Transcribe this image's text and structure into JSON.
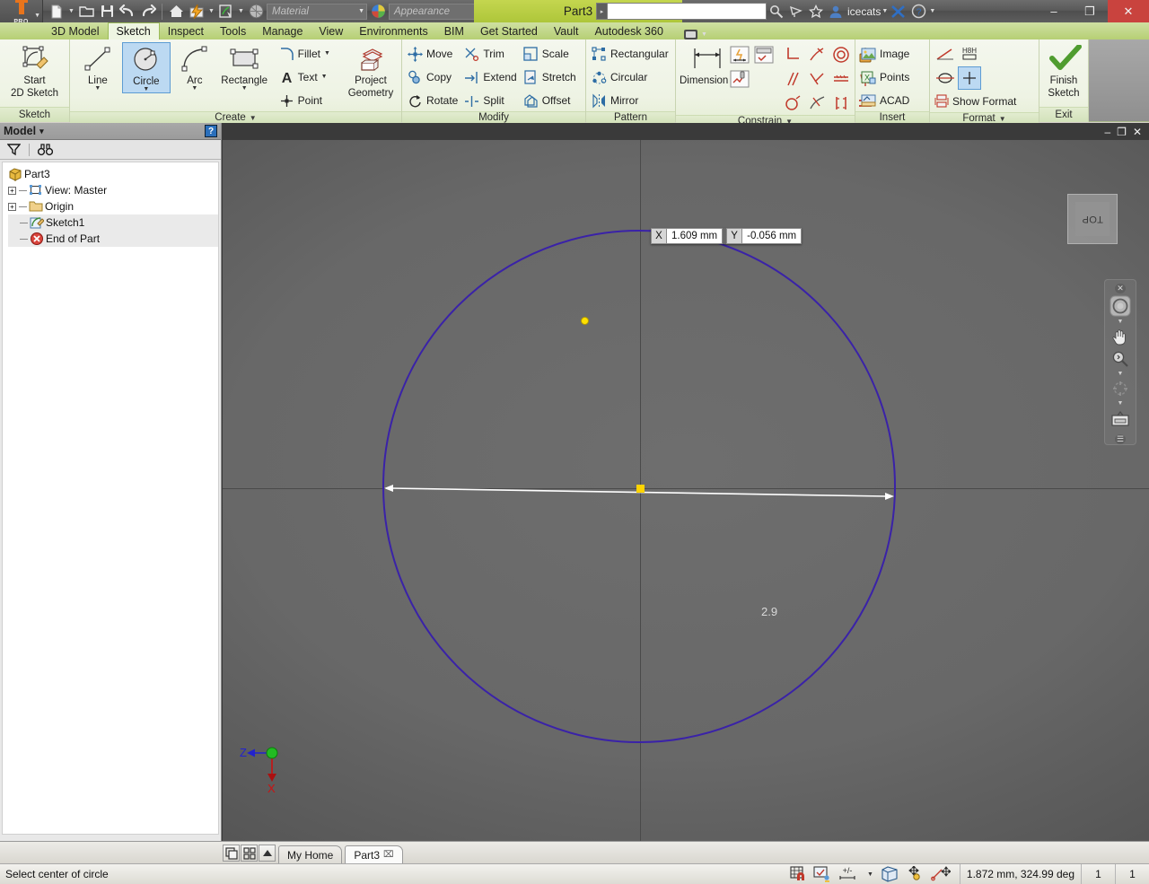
{
  "app": {
    "product": "PRO",
    "document_title": "Part3",
    "user_name": "icecats",
    "search_placeholder": ""
  },
  "quick_access": {
    "items": [
      {
        "name": "new-file",
        "icon": "new-document-icon"
      },
      {
        "name": "open-file",
        "icon": "open-folder-icon"
      },
      {
        "name": "save-file",
        "icon": "floppy-save-icon"
      },
      {
        "name": "undo",
        "icon": "undo-arrow-icon"
      },
      {
        "name": "redo",
        "icon": "redo-arrow-icon"
      },
      {
        "name": "home-view",
        "icon": "home-icon"
      },
      {
        "name": "appearance-flash",
        "icon": "lightning-icon"
      },
      {
        "name": "sketch-visibility",
        "icon": "sketch-visibility-icon"
      },
      {
        "name": "material-sphere",
        "icon": "material-sphere-icon"
      }
    ],
    "material_value": "Material",
    "appearance_value": "Appearance"
  },
  "title_icons": [
    {
      "name": "search-magnifier-icon"
    },
    {
      "name": "satellite-dish-icon"
    },
    {
      "name": "favorites-star-icon"
    },
    {
      "name": "user-account-icon"
    },
    {
      "name": "exchange-x-icon"
    },
    {
      "name": "help-question-icon"
    }
  ],
  "window_controls": {
    "minimize": "–",
    "restore": "❐",
    "close": "✕"
  },
  "ribbon_tabs": {
    "items": [
      {
        "label": "3D Model",
        "active": false
      },
      {
        "label": "Sketch",
        "active": true
      },
      {
        "label": "Inspect",
        "active": false
      },
      {
        "label": "Tools",
        "active": false
      },
      {
        "label": "Manage",
        "active": false
      },
      {
        "label": "View",
        "active": false
      },
      {
        "label": "Environments",
        "active": false
      },
      {
        "label": "BIM",
        "active": false
      },
      {
        "label": "Get Started",
        "active": false
      },
      {
        "label": "Vault",
        "active": false
      },
      {
        "label": "Autodesk 360",
        "active": false
      }
    ]
  },
  "ribbon": {
    "panels": [
      {
        "title": "Sketch",
        "has_dropdown": false,
        "big_buttons": [
          {
            "label": "Start\n2D Sketch",
            "label_line1": "Start",
            "label_line2": "2D Sketch",
            "icon": "start-2d-sketch-icon",
            "selected": false,
            "has_arrow": true
          }
        ]
      },
      {
        "title": "Create",
        "has_dropdown": true,
        "big_buttons": [
          {
            "label_line1": "Line",
            "label_line2": "",
            "icon": "line-icon",
            "selected": false,
            "has_arrow": true
          },
          {
            "label_line1": "Circle",
            "label_line2": "",
            "icon": "circle-icon",
            "selected": true,
            "has_arrow": true
          },
          {
            "label_line1": "Arc",
            "label_line2": "",
            "icon": "arc-icon",
            "selected": false,
            "has_arrow": true
          },
          {
            "label_line1": "Rectangle",
            "label_line2": "",
            "icon": "rectangle-icon",
            "selected": false,
            "has_arrow": true
          }
        ],
        "small_buttons": [
          {
            "label": "Fillet",
            "icon": "fillet-icon",
            "has_arrow": true
          },
          {
            "label": "Text",
            "icon": "text-A-icon",
            "has_arrow": true
          },
          {
            "label": "Point",
            "icon": "point-icon",
            "has_arrow": false
          }
        ],
        "trailing_big": [
          {
            "label_line1": "Project",
            "label_line2": "Geometry",
            "icon": "project-geometry-icon",
            "has_arrow": true
          }
        ]
      },
      {
        "title": "Modify",
        "has_dropdown": false,
        "columns": [
          [
            {
              "label": "Move",
              "icon": "move-icon"
            },
            {
              "label": "Copy",
              "icon": "copy-icon"
            },
            {
              "label": "Rotate",
              "icon": "rotate-icon"
            }
          ],
          [
            {
              "label": "Trim",
              "icon": "trim-scissors-icon"
            },
            {
              "label": "Extend",
              "icon": "extend-icon"
            },
            {
              "label": "Split",
              "icon": "split-icon"
            }
          ],
          [
            {
              "label": "Scale",
              "icon": "scale-icon"
            },
            {
              "label": "Stretch",
              "icon": "stretch-icon"
            },
            {
              "label": "Offset",
              "icon": "offset-icon"
            }
          ]
        ]
      },
      {
        "title": "Pattern",
        "has_dropdown": false,
        "columns": [
          [
            {
              "label": "Rectangular",
              "icon": "rectangular-pattern-icon"
            },
            {
              "label": "Circular",
              "icon": "circular-pattern-icon"
            },
            {
              "label": "Mirror",
              "icon": "mirror-icon"
            }
          ]
        ]
      },
      {
        "title": "Constrain",
        "has_dropdown": true,
        "big_buttons": [
          {
            "label_line1": "Dimension",
            "label_line2": "",
            "icon": "dimension-icon",
            "selected": false,
            "has_arrow": false
          }
        ],
        "icon_grid_left": [
          {
            "name": "auto-dimension-icon"
          },
          {
            "name": "show-constraints-icon"
          },
          {
            "name": "constraint-settings-icon"
          }
        ],
        "icon_grid": [
          {
            "name": "perpendicular-constraint-icon"
          },
          {
            "name": "tangent-constraint-icon"
          },
          {
            "name": "concentric-constraint-icon"
          },
          {
            "name": "fix-constraint-icon"
          },
          {
            "name": "parallel-constraint-icon"
          },
          {
            "name": "coincident-constraint-icon"
          },
          {
            "name": "collinear-constraint-icon"
          },
          {
            "name": "symmetric-constraint-icon"
          },
          {
            "name": "smooth-constraint-icon"
          },
          {
            "name": "equal-curvature-icon"
          },
          {
            "name": "horizontal-constraint-icon"
          },
          {
            "name": "equal-constraint-icon"
          }
        ]
      },
      {
        "title": "Insert",
        "has_dropdown": false,
        "columns": [
          [
            {
              "label": "Image",
              "icon": "image-icon"
            },
            {
              "label": "Points",
              "icon": "points-excel-icon"
            },
            {
              "label": "ACAD",
              "icon": "acad-import-icon"
            }
          ]
        ]
      },
      {
        "title": "Format",
        "has_dropdown": true,
        "icon_grid": [
          {
            "name": "construction-line-icon"
          },
          {
            "name": "driven-dimension-icon"
          },
          {
            "name": "centerline-icon"
          },
          {
            "name": "center-point-icon",
            "selected": true
          }
        ],
        "columns": [
          [
            {
              "label": "Show Format",
              "icon": "show-format-icon"
            }
          ]
        ]
      },
      {
        "title": "Exit",
        "has_dropdown": false,
        "big_buttons": [
          {
            "label_line1": "Finish",
            "label_line2": "Sketch",
            "icon": "green-check-icon",
            "selected": false,
            "has_arrow": false
          }
        ]
      }
    ]
  },
  "browser": {
    "header_title": "Model",
    "header_caret": "▾",
    "help_icon": "help-question-icon",
    "tools": [
      {
        "name": "filter-funnel-icon"
      },
      {
        "name": "binoculars-search-icon"
      }
    ],
    "tree": [
      {
        "label": "Part3",
        "icon": "part-cube-icon",
        "indent": 0,
        "expander": "",
        "selected": false
      },
      {
        "label": "View: Master",
        "icon": "view-master-icon",
        "indent": 1,
        "expander": "+",
        "selected": false
      },
      {
        "label": "Origin",
        "icon": "folder-icon",
        "indent": 1,
        "expander": "+",
        "selected": false
      },
      {
        "label": "Sketch1",
        "icon": "sketch-icon",
        "indent": 1,
        "expander": "",
        "selected": true
      },
      {
        "label": "End of Part",
        "icon": "end-of-part-icon",
        "indent": 1,
        "expander": "",
        "selected": true
      }
    ]
  },
  "document_window_controls": {
    "minimize": "–",
    "restore": "❐",
    "close": "✕"
  },
  "canvas": {
    "coordinate_input": {
      "x_label": "X",
      "x_value": "1.609 mm",
      "y_label": "Y",
      "y_value": "-0.056 mm"
    },
    "dimension_value": "2.9",
    "viewcube_label": "TOP",
    "axis_triad": {
      "z_label": "Z",
      "x_label": "X"
    },
    "nav_bar": [
      {
        "name": "steering-wheel-icon"
      },
      {
        "name": "pan-hand-icon"
      },
      {
        "name": "zoom-magnifier-icon"
      },
      {
        "name": "orbit-icon"
      },
      {
        "name": "look-at-window-icon"
      },
      {
        "name": "nav-settings-icon"
      }
    ],
    "circle_color": "#3a22a8",
    "center_point_color": "#ffd400",
    "cursor_dot_color": "#ffe100"
  },
  "bottom_tabs": {
    "view_icons": [
      {
        "name": "cascade-windows-icon"
      },
      {
        "name": "tile-windows-icon"
      },
      {
        "name": "scroll-up-icon"
      }
    ],
    "tabs": [
      {
        "label": "My Home",
        "active": false,
        "closable": false
      },
      {
        "label": "Part3",
        "active": true,
        "closable": true,
        "close_glyph": "⌧"
      }
    ]
  },
  "status_bar": {
    "message": "Select center of circle",
    "icons": [
      {
        "name": "snap-grid-icon"
      },
      {
        "name": "constraint-inference-icon"
      },
      {
        "name": "dimension-display-icon"
      },
      {
        "name": "view-cube-toggle-icon"
      },
      {
        "name": "move-light-icon"
      },
      {
        "name": "relax-drag-icon"
      }
    ],
    "coordinate_readout": "1.872 mm, 324.99 deg",
    "cell_1": "1",
    "cell_2": "1"
  },
  "colors": {
    "ribbon_green": "#b6cf74",
    "title_green": "#c4d64f",
    "selection_blue": "#bcd9f2",
    "close_red": "#c9433e",
    "sketch_circle": "#3a22a8"
  }
}
